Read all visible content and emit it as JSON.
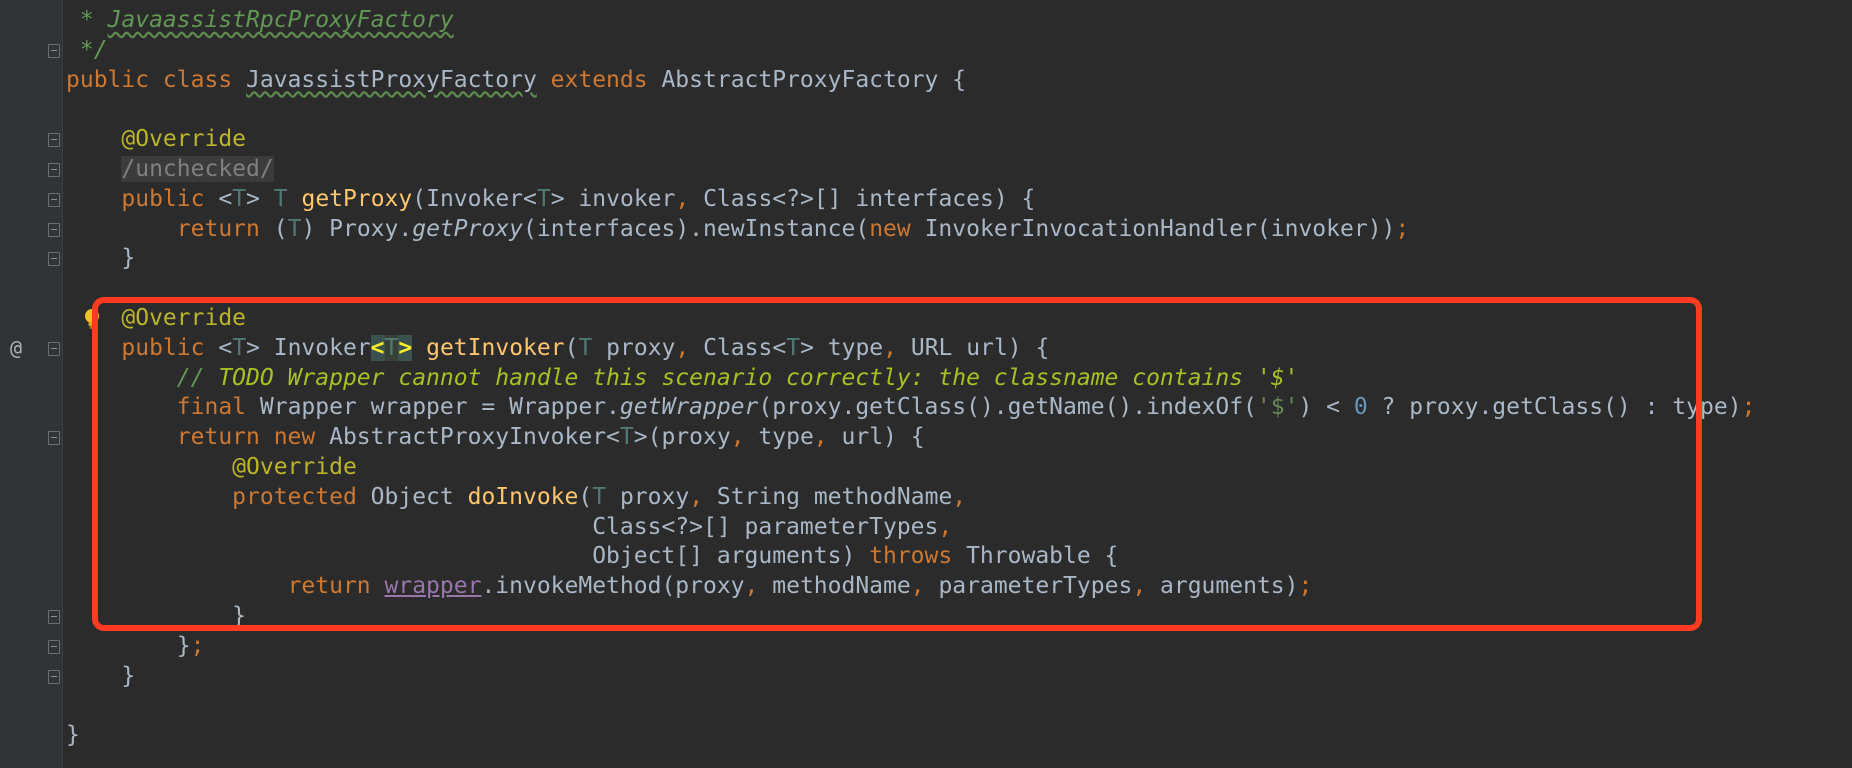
{
  "editor": {
    "gutter_override_marker": "@",
    "lines": [
      {
        "id": "l1",
        "segments": [
          {
            "t": " * ",
            "c": "cmt-doc"
          },
          {
            "t": "JavaassistRpcProxyFactory",
            "c": "cmt-doc squiggle"
          }
        ]
      },
      {
        "id": "l2",
        "segments": [
          {
            "t": " */",
            "c": "cmt-doc"
          }
        ]
      },
      {
        "id": "l3",
        "segments": [
          {
            "t": "public class ",
            "c": "kw"
          },
          {
            "t": "JavassistProxyFactory",
            "c": "squiggle"
          },
          {
            "t": " "
          },
          {
            "t": "extends ",
            "c": "kw"
          },
          {
            "t": "AbstractProxyFactory {"
          }
        ]
      },
      {
        "id": "l4",
        "segments": []
      },
      {
        "id": "l5",
        "segments": [
          {
            "t": "    "
          },
          {
            "t": "@Override",
            "c": "ann"
          }
        ]
      },
      {
        "id": "l6",
        "segments": [
          {
            "t": "    "
          },
          {
            "t": "/unchecked/",
            "c": "unchecked"
          }
        ]
      },
      {
        "id": "l7",
        "segments": [
          {
            "t": "    "
          },
          {
            "t": "public ",
            "c": "kw"
          },
          {
            "t": "<"
          },
          {
            "t": "T",
            "c": "tp"
          },
          {
            "t": "> "
          },
          {
            "t": "T",
            "c": "tp"
          },
          {
            "t": " "
          },
          {
            "t": "getProxy",
            "c": "fn"
          },
          {
            "t": "(Invoker<"
          },
          {
            "t": "T",
            "c": "tp"
          },
          {
            "t": "> invoker"
          },
          {
            "t": ", ",
            "c": "kw"
          },
          {
            "t": "Class<?>[] interfaces) {"
          }
        ]
      },
      {
        "id": "l8",
        "segments": [
          {
            "t": "        "
          },
          {
            "t": "return ",
            "c": "kw"
          },
          {
            "t": "("
          },
          {
            "t": "T",
            "c": "tp"
          },
          {
            "t": ") Proxy."
          },
          {
            "t": "getProxy",
            "c": "italic"
          },
          {
            "t": "(interfaces).newInstance("
          },
          {
            "t": "new ",
            "c": "kw"
          },
          {
            "t": "InvokerInvocationHandler(invoker))"
          },
          {
            "t": ";",
            "c": "kw"
          }
        ]
      },
      {
        "id": "l9",
        "segments": [
          {
            "t": "    }"
          }
        ]
      },
      {
        "id": "l10",
        "segments": []
      },
      {
        "id": "l11",
        "segments": [
          {
            "t": "    "
          },
          {
            "t": "@Override",
            "c": "ann"
          }
        ]
      },
      {
        "id": "l12",
        "segments": [
          {
            "t": "    "
          },
          {
            "t": "public ",
            "c": "kw"
          },
          {
            "t": "<"
          },
          {
            "t": "T",
            "c": "tp"
          },
          {
            "t": "> Invoker"
          },
          {
            "t": "<",
            "c": "brace-match"
          },
          {
            "t": "T",
            "c": "brace-inner"
          },
          {
            "t": ">",
            "c": "brace-match"
          },
          {
            "t": " "
          },
          {
            "t": "getInvoker",
            "c": "fn"
          },
          {
            "t": "("
          },
          {
            "t": "T",
            "c": "tp"
          },
          {
            "t": " proxy"
          },
          {
            "t": ", ",
            "c": "kw"
          },
          {
            "t": "Class<"
          },
          {
            "t": "T",
            "c": "tp"
          },
          {
            "t": "> type"
          },
          {
            "t": ", ",
            "c": "kw"
          },
          {
            "t": "URL url) {"
          }
        ]
      },
      {
        "id": "l13",
        "segments": [
          {
            "t": "        "
          },
          {
            "t": "// ",
            "c": "cmt-doc"
          },
          {
            "t": "TODO Wrapper cannot handle this scenario correctly: the classname contains '$'",
            "c": "todo"
          }
        ]
      },
      {
        "id": "l14",
        "segments": [
          {
            "t": "        "
          },
          {
            "t": "final ",
            "c": "kw"
          },
          {
            "t": "Wrapper wrapper = Wrapper."
          },
          {
            "t": "getWrapper",
            "c": "italic"
          },
          {
            "t": "(proxy.getClass().getName().indexOf("
          },
          {
            "t": "'$'",
            "c": "str"
          },
          {
            "t": ") < "
          },
          {
            "t": "0",
            "c": "num"
          },
          {
            "t": " ? proxy.getClass() : type)"
          },
          {
            "t": ";",
            "c": "kw"
          }
        ]
      },
      {
        "id": "l15",
        "segments": [
          {
            "t": "        "
          },
          {
            "t": "return new ",
            "c": "kw"
          },
          {
            "t": "AbstractProxyInvoker<"
          },
          {
            "t": "T",
            "c": "tp"
          },
          {
            "t": ">(proxy"
          },
          {
            "t": ", ",
            "c": "kw"
          },
          {
            "t": "type"
          },
          {
            "t": ", ",
            "c": "kw"
          },
          {
            "t": "url) {"
          }
        ]
      },
      {
        "id": "l16",
        "segments": [
          {
            "t": "            "
          },
          {
            "t": "@Override",
            "c": "ann"
          }
        ]
      },
      {
        "id": "l17",
        "segments": [
          {
            "t": "            "
          },
          {
            "t": "protected ",
            "c": "kw"
          },
          {
            "t": "Object "
          },
          {
            "t": "doInvoke",
            "c": "fn"
          },
          {
            "t": "("
          },
          {
            "t": "T",
            "c": "tp"
          },
          {
            "t": " proxy"
          },
          {
            "t": ", ",
            "c": "kw"
          },
          {
            "t": "String methodName"
          },
          {
            "t": ",",
            "c": "kw"
          }
        ]
      },
      {
        "id": "l18",
        "segments": [
          {
            "t": "                                      Class<?>[] parameterTypes"
          },
          {
            "t": ",",
            "c": "kw"
          }
        ]
      },
      {
        "id": "l19",
        "segments": [
          {
            "t": "                                      Object[] arguments) "
          },
          {
            "t": "throws ",
            "c": "kw"
          },
          {
            "t": "Throwable {"
          }
        ]
      },
      {
        "id": "l20",
        "segments": [
          {
            "t": "                "
          },
          {
            "t": "return ",
            "c": "kw"
          },
          {
            "t": "wrapper",
            "c": "field"
          },
          {
            "t": ".invokeMethod(proxy"
          },
          {
            "t": ", ",
            "c": "kw"
          },
          {
            "t": "methodName"
          },
          {
            "t": ", ",
            "c": "kw"
          },
          {
            "t": "parameterTypes"
          },
          {
            "t": ", ",
            "c": "kw"
          },
          {
            "t": "arguments)"
          },
          {
            "t": ";",
            "c": "kw"
          }
        ]
      },
      {
        "id": "l21",
        "segments": [
          {
            "t": "            }"
          }
        ]
      },
      {
        "id": "l22",
        "segments": [
          {
            "t": "        }"
          },
          {
            "t": ";",
            "c": "kw"
          }
        ]
      },
      {
        "id": "l23",
        "segments": [
          {
            "t": "    }"
          }
        ]
      },
      {
        "id": "l24",
        "segments": []
      },
      {
        "id": "l25",
        "segments": [
          {
            "t": "}"
          }
        ]
      }
    ]
  },
  "colors": {
    "background": "#2b2b2b",
    "gutter": "#313335",
    "keyword": "#cc7832",
    "annotation": "#bbb529",
    "function": "#ffc66d",
    "type_param": "#507874",
    "doc_comment": "#629755",
    "todo": "#a8c023",
    "highlight_box": "#ff3b21"
  },
  "icons": {
    "bulb": "lightbulb-icon",
    "fold": "fold-marker-icon",
    "override": "override-marker-icon"
  }
}
